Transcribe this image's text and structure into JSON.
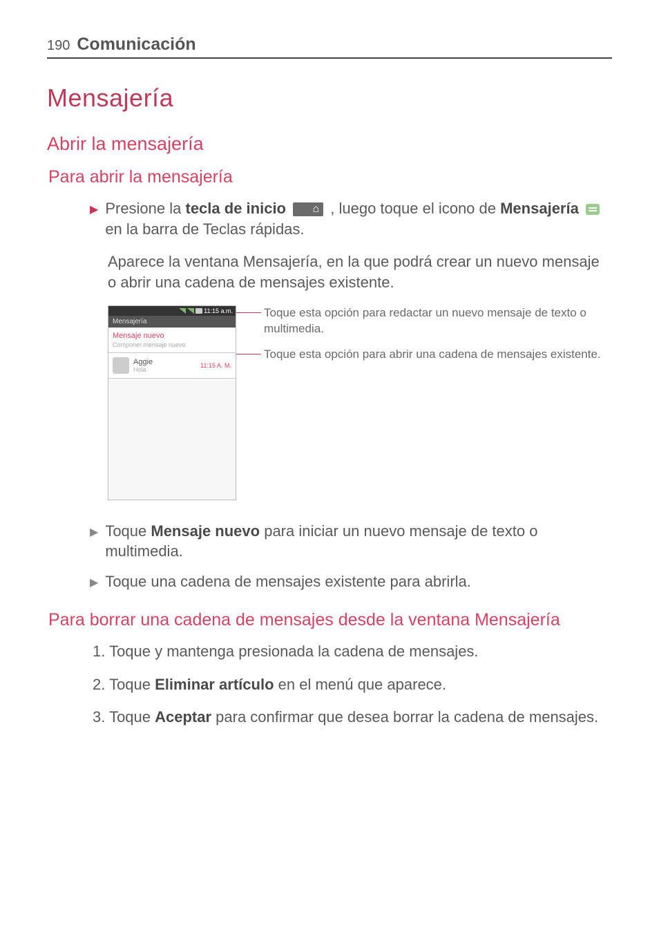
{
  "header": {
    "page_number": "190",
    "section": "Comunicación"
  },
  "h1": "Mensajería",
  "h2": "Abrir la mensajería",
  "h3a": "Para abrir la mensajería",
  "bullet1": {
    "pre": "Presione la ",
    "b1": "tecla de inicio",
    "mid1": " , luego toque el icono de ",
    "b2": "Mensajería",
    "post": " en la barra de Teclas rápidas."
  },
  "para1": "Aparece la ventana Mensajería, en la que podrá crear un nuevo mensaje o abrir una cadena de mensajes existente.",
  "mock": {
    "status_time": "11:15 a.m.",
    "title": "Mensajería",
    "compose_title": "Mensaje nuevo",
    "compose_sub": "Componer mensaje nuevo",
    "thread_name": "Aggie",
    "thread_msg": "Hola",
    "thread_time": "11:15 A. M."
  },
  "callout1": "Toque esta opción para redactar un nuevo mensaje de texto o multimedia.",
  "callout2": "Toque esta opción para abrir una cadena de mensajes existente.",
  "bullet2": {
    "pre": "Toque ",
    "b1": "Mensaje nuevo",
    "post": " para iniciar un nuevo mensaje de texto o multimedia."
  },
  "bullet3": "Toque una cadena de mensajes existente para abrirla.",
  "h3b": "Para borrar una cadena de mensajes desde la ventana Mensajería",
  "steps": {
    "s1": "1. Toque y mantenga presionada la cadena de mensajes.",
    "s2_pre": "2. Toque ",
    "s2_b": "Eliminar artículo",
    "s2_post": " en el menú que aparece.",
    "s3_pre": "3. Toque ",
    "s3_b": "Aceptar",
    "s3_post": " para confirmar que desea borrar la cadena de mensajes."
  }
}
